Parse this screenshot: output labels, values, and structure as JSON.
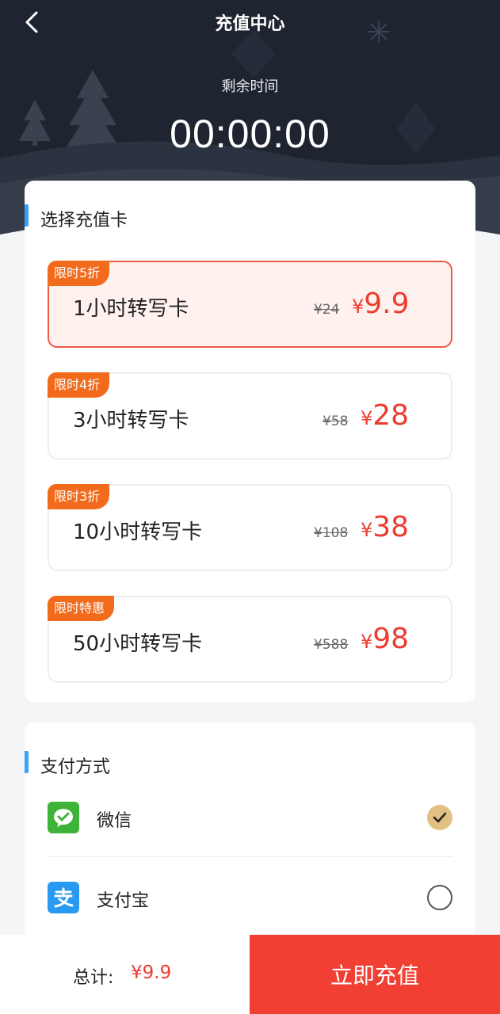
{
  "header": {
    "title": "充值中心",
    "remaining_label": "剩余时间",
    "countdown": "00:00:00",
    "back_icon": "chevron-left-icon"
  },
  "cards_section": {
    "title": "选择充值卡",
    "items": [
      {
        "badge": "限时5折",
        "name": "1小时转写卡",
        "original_price": "¥24",
        "currency": "¥",
        "price": "9.9",
        "selected": true
      },
      {
        "badge": "限时4折",
        "name": "3小时转写卡",
        "original_price": "¥58",
        "currency": "¥",
        "price": "28",
        "selected": false
      },
      {
        "badge": "限时3折",
        "name": "10小时转写卡",
        "original_price": "¥108",
        "currency": "¥",
        "price": "38",
        "selected": false
      },
      {
        "badge": "限时特惠",
        "name": "50小时转写卡",
        "original_price": "¥588",
        "currency": "¥",
        "price": "98",
        "selected": false
      }
    ]
  },
  "payment_section": {
    "title": "支付方式",
    "methods": [
      {
        "label": "微信",
        "icon": "wechat-pay-icon",
        "selected": true
      },
      {
        "label": "支付宝",
        "icon": "alipay-icon",
        "selected": false
      }
    ]
  },
  "bottom_bar": {
    "total_label": "总计:",
    "total_value": "¥9.9",
    "pay_button": "立即充值"
  },
  "colors": {
    "header_bg": "#1e2430",
    "accent_red": "#ee3b2f",
    "badge_orange": "#f26a1b",
    "section_bar_blue": "#3aa0ff",
    "radio_checked": "#e2c084",
    "wechat_green": "#3db337",
    "alipay_blue": "#2a9af0"
  }
}
